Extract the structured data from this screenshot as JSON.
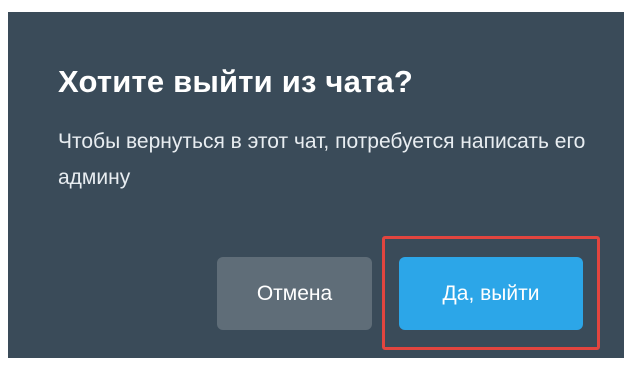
{
  "dialog": {
    "title": "Хотите выйти из чата?",
    "message": "Чтобы вернуться в этот чат, потребуется написать его админу",
    "cancel_label": "Отмена",
    "confirm_label": "Да, выйти"
  },
  "colors": {
    "dialog_background": "#3a4b59",
    "cancel_button": "#5f6d78",
    "confirm_button": "#2ca6e8",
    "highlight_border": "#e2453f"
  }
}
